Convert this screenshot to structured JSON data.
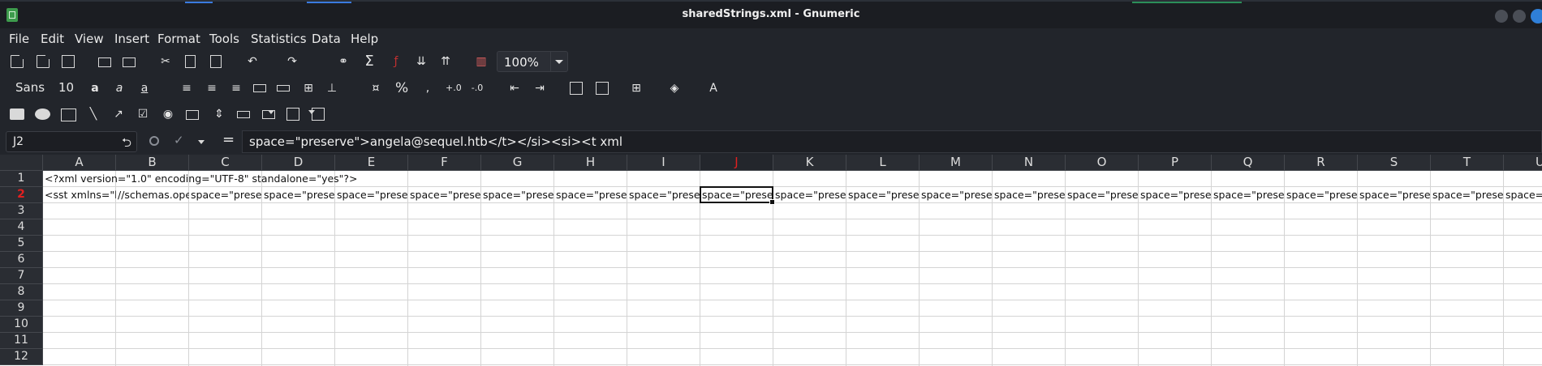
{
  "window": {
    "title": "sharedStrings.xml - Gnumeric"
  },
  "menu": [
    "File",
    "Edit",
    "View",
    "Insert",
    "Format",
    "Tools",
    "Statistics",
    "Data",
    "Help"
  ],
  "toolbar": {
    "zoom": "100%",
    "font_name": "Sans",
    "font_size": "10"
  },
  "formula_bar": {
    "cell_ref": "J2",
    "equals": "=",
    "content": "space=\"preserve\">angela@sequel.htb</t></si><si><t xml"
  },
  "sheet": {
    "columns": [
      "A",
      "B",
      "C",
      "D",
      "E",
      "F",
      "G",
      "H",
      "I",
      "J",
      "K",
      "L",
      "M",
      "N",
      "O",
      "P",
      "Q",
      "R",
      "S",
      "T",
      "U"
    ],
    "rows": [
      "1",
      "2",
      "3",
      "4",
      "5",
      "6",
      "7",
      "8",
      "9",
      "10",
      "11",
      "12"
    ],
    "active_column": "J",
    "active_row": "2",
    "cells": {
      "A1": "<?xml version=\"1.0\" encoding=\"UTF-8\" standalone=\"yes\"?>",
      "A2": "<sst xmlns=\"h",
      "B2": "//schemas.ope",
      "C2": "space=\"preser",
      "D2": "space=\"preser",
      "E2": "space=\"preser",
      "F2": "space=\"preser",
      "G2": "space=\"preser",
      "H2": "space=\"preser",
      "I2": "space=\"preser",
      "J2": "space=\"prese",
      "K2": "space=\"preser",
      "L2": "space=\"preser",
      "M2": "space=\"preser",
      "N2": "space=\"preser",
      "O2": "space=\"preser",
      "P2": "space=\"preser",
      "Q2": "space=\"preser",
      "R2": "space=\"preser",
      "S2": "space=\"preser",
      "T2": "space=\"preser",
      "U2": "space=\""
    }
  }
}
